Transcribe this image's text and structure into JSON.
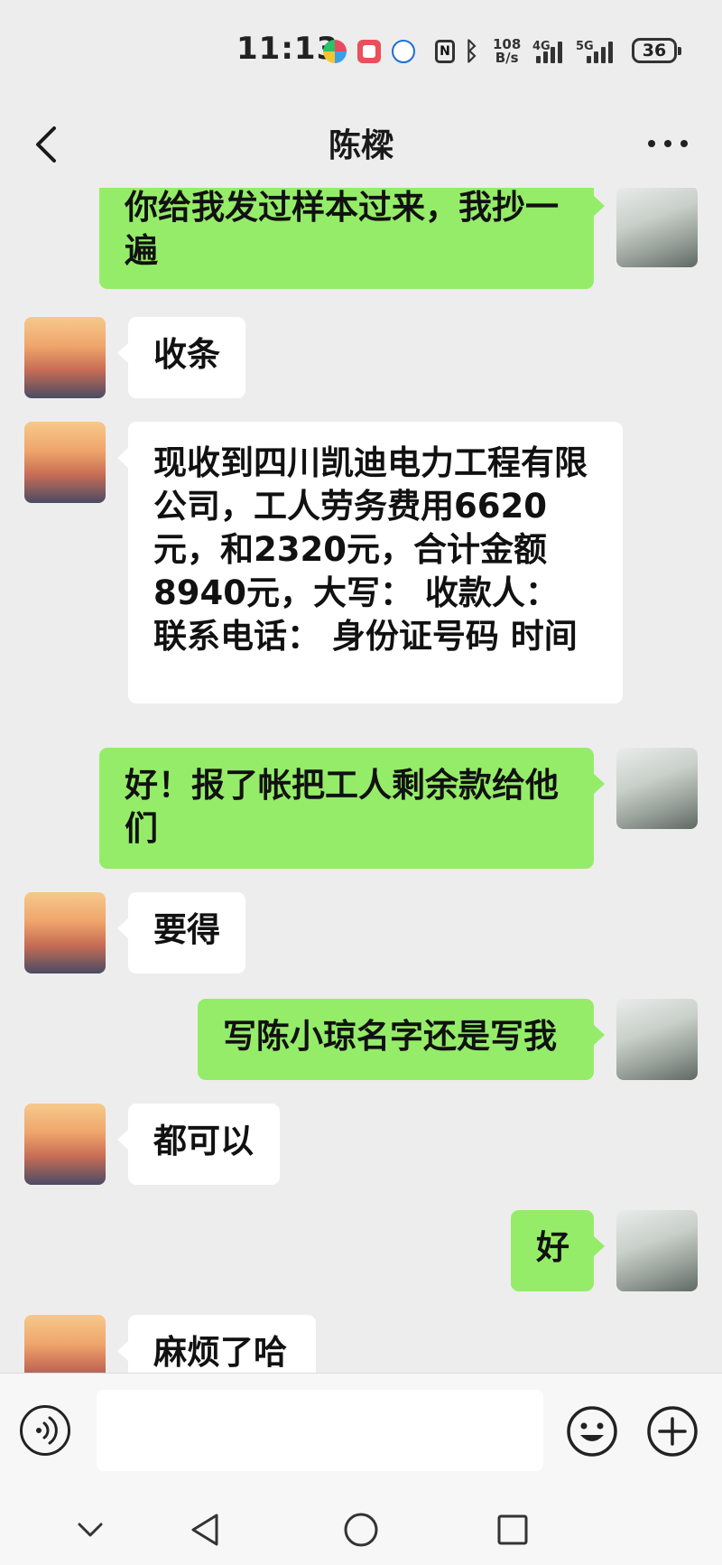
{
  "status_bar": {
    "time": "11:13",
    "net_speed_top": "108",
    "net_speed_bottom": "B/s",
    "signal_1": "4G",
    "signal_2": "5G",
    "battery": "36"
  },
  "header": {
    "title": "陈樑",
    "back_icon": "chevron-left-icon",
    "more_icon": "more-dots-icon"
  },
  "messages": [
    {
      "side": "right",
      "text": "你给我发过样本过来，我抄一遍"
    },
    {
      "side": "left",
      "text": "收条"
    },
    {
      "side": "left",
      "text": "现收到四川凯迪电力工程有限公司，工人劳务费用6620元，和2320元，合计金额8940元，大写：           收款人：                   联系电话：        身份证号码         时间"
    },
    {
      "side": "right",
      "text": "好！报了帐把工人剩余款给他们"
    },
    {
      "side": "left",
      "text": "要得"
    },
    {
      "side": "right",
      "text": "写陈小琼名字还是写我"
    },
    {
      "side": "left",
      "text": "都可以"
    },
    {
      "side": "right",
      "text": "好"
    },
    {
      "side": "left",
      "text": "麻烦了哈"
    }
  ],
  "input_bar": {
    "value": "",
    "icons": [
      "voice-icon",
      "emoji-icon",
      "plus-icon"
    ]
  },
  "system_nav": [
    "hide-keyboard-icon",
    "back-triangle-icon",
    "home-circle-icon",
    "recents-square-icon"
  ]
}
